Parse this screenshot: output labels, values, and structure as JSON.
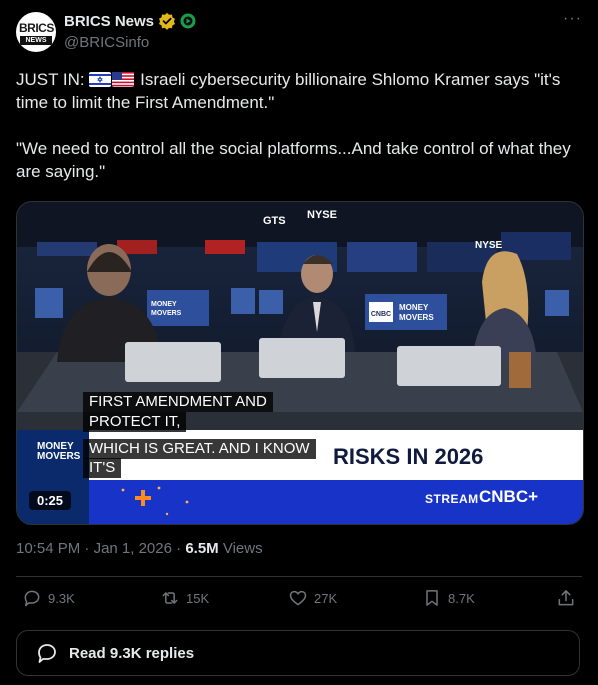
{
  "author": {
    "name": "BRICS News",
    "handle": "@BRICSinfo",
    "avatar_text_top": "BRICS",
    "avatar_text_bottom": "NEWS"
  },
  "tweet": {
    "lead": "JUST IN:",
    "flags": [
      "israel-flag-icon",
      "us-flag-icon"
    ],
    "line1": "Israeli cybersecurity billionaire Shlomo Kramer says \"it's time to limit the First Amendment.\"",
    "line2": "\"We need to control all the social platforms...And take control of what they are saying.\""
  },
  "video": {
    "captions": [
      "FIRST AMENDMENT AND",
      "PROTECT IT,",
      "WHICH IS GREAT. AND I KNOW",
      "IT'S"
    ],
    "lower_third_title": "RISKS IN 2026",
    "show_label_1": "MONEY",
    "show_label_2": "MOVERS",
    "stream_label": "STREAM",
    "stream_brand": "CNBC+",
    "duration": "0:25",
    "backdrop_texts": {
      "nyse": "NYSE",
      "gts": "GTS",
      "nyse2": "NYSE",
      "money_movers_1": "MONEY",
      "money_movers_2": "MOVERS",
      "cnbc": "CNBC"
    }
  },
  "meta": {
    "time": "10:54 PM",
    "separator": "·",
    "date": "Jan 1, 2026",
    "views_count": "6.5M",
    "views_label": "Views"
  },
  "actions": {
    "replies": "9.3K",
    "reposts": "15K",
    "likes": "27K",
    "bookmarks": "8.7K"
  },
  "read_replies": "Read 9.3K replies",
  "colors": {
    "background": "#000000",
    "text": "#e7e9ea",
    "muted": "#71767b",
    "border": "#2f3336",
    "verified_gold": "#e2b719",
    "affiliate_green": "#1a9e4b"
  }
}
